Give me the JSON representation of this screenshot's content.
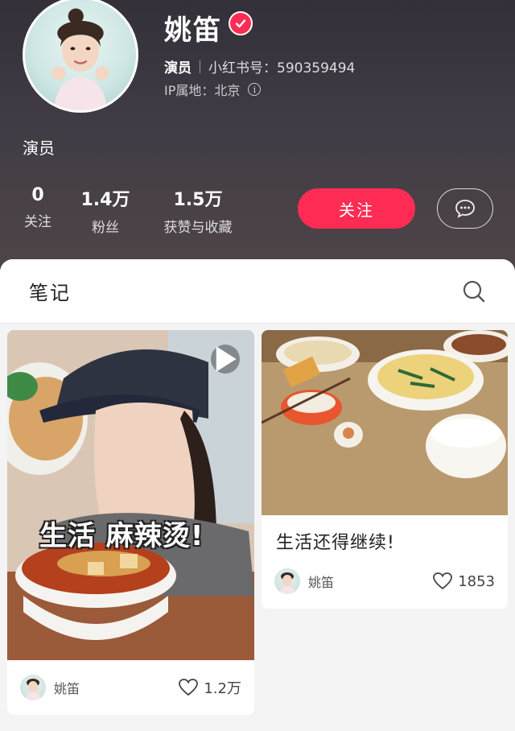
{
  "profile": {
    "name": "姚笛",
    "role": "演员",
    "account_label": "小红书号：590359494",
    "ip_label": "IP属地：",
    "ip_location": "北京",
    "bio": "演员"
  },
  "stats": [
    {
      "value": "0",
      "label": "关注"
    },
    {
      "value": "1.4万",
      "label": "粉丝"
    },
    {
      "value": "1.5万",
      "label": "获赞与收藏"
    }
  ],
  "actions": {
    "follow_label": "关注"
  },
  "tabs": {
    "notes_label": "笔记"
  },
  "notes": [
    {
      "overlay_text": "生活  麻辣烫!",
      "author": "姚笛",
      "likes": "1.2万",
      "is_video": true
    },
    {
      "title": "生活还得继续!",
      "author": "姚笛",
      "likes": "1853",
      "is_video": false
    }
  ],
  "colors": {
    "accent": "#fe2c55",
    "header_bg": "#3c3740"
  }
}
